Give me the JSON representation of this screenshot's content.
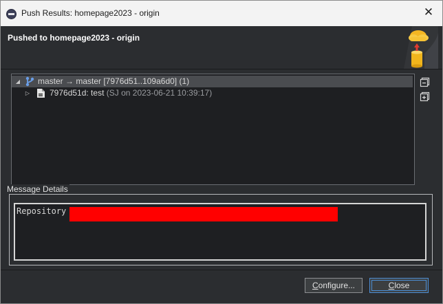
{
  "window": {
    "title": "Push Results: homepage2023 - origin",
    "icon": "eclipse-app-icon",
    "close_glyph": "✕"
  },
  "banner": {
    "title": "Pushed to homepage2023 - origin",
    "icon": "cloud-upload-database-icon"
  },
  "tree": {
    "rows": [
      {
        "expander": "◢",
        "icon": "branch-icon",
        "label": "master → master [7976d51..109a6d0] (1)",
        "selected": true
      },
      {
        "expander": "▷",
        "icon": "commit-file-icon",
        "label": "7976d51d: test",
        "meta": "(SJ on 2023-06-21 10:39:17)"
      }
    ],
    "side_buttons": [
      "collapse-all-icon",
      "expand-all-icon"
    ]
  },
  "message_details": {
    "legend": "Message Details",
    "text": "Repository",
    "redaction_color": "#ff0000"
  },
  "buttons": {
    "configure": {
      "pre": "",
      "mnemonic": "C",
      "post": "onfigure..."
    },
    "close": {
      "pre": "",
      "mnemonic": "C",
      "post": "lose"
    }
  },
  "colors": {
    "background": "#2b2d30",
    "tree_background": "#1e1f22",
    "selection": "#4a4c50",
    "focus_accent": "#4d8fd6",
    "branch_icon": "#6a9ee8"
  }
}
